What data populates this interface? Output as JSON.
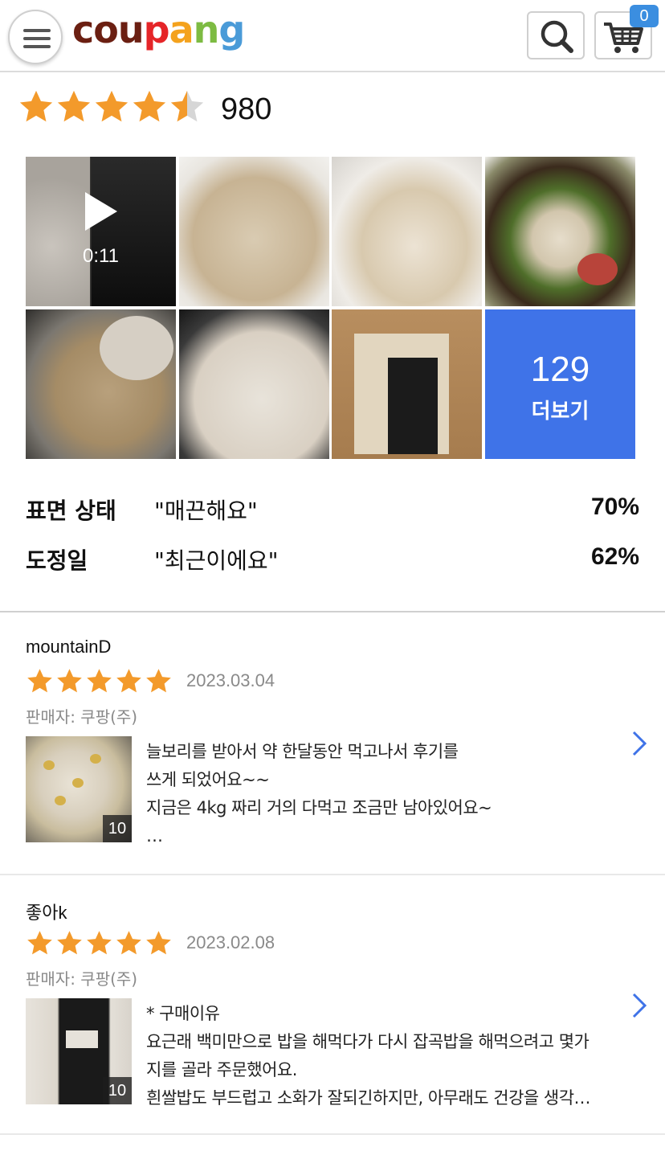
{
  "header": {
    "logo_text": "coupang",
    "cart_count": "0",
    "logo_colors": [
      "#6b1f12",
      "#6b1f12",
      "#6b1f12",
      "#e52528",
      "#f4a21d",
      "#7dbb42",
      "#4a9bd8"
    ]
  },
  "rating_summary": {
    "rating": 4.5,
    "count": "980",
    "star_color": "#f39a2b"
  },
  "photos": {
    "video_duration": "0:11",
    "more_count": "129",
    "more_label": "더보기",
    "more_bg": "#3f73e8"
  },
  "survey": [
    {
      "key": "표면 상태",
      "value": "\"매끈해요\"",
      "percent": "70%"
    },
    {
      "key": "도정일",
      "value": "\"최근이에요\"",
      "percent": "62%"
    }
  ],
  "reviews": [
    {
      "user": "mountainD",
      "rating": 5,
      "date": "2023.03.04",
      "seller": "판매자: 쿠팡(주)",
      "photo_count": "10",
      "lines": [
        "늘보리를 받아서 약 한달동안 먹고나서 후기를",
        "쓰게 되었어요~~",
        "지금은 4kg 짜리 거의 다먹고 조금만 남아있어요~",
        "…"
      ]
    },
    {
      "user": "좋아k",
      "rating": 5,
      "date": "2023.02.08",
      "seller": "판매자: 쿠팡(주)",
      "photo_count": "10",
      "lines": [
        "* 구매이유",
        "요근래 백미만으로 밥을 해먹다가 다시 잡곡밥을 해먹으려고 몇가",
        "지를 골라 주문했어요.",
        "흰쌀밥도 부드럽고 소화가 잘되긴하지만, 아무래도 건강을 생각…"
      ]
    }
  ]
}
